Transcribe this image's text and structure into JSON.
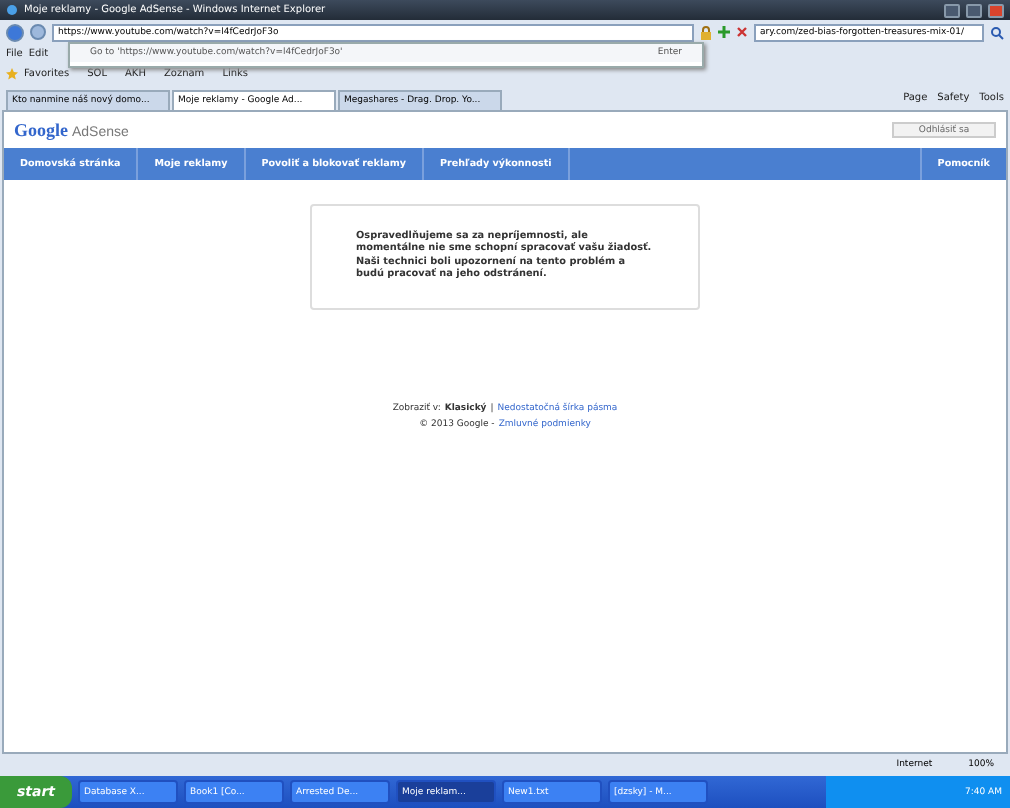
{
  "window": {
    "title": "Moje reklamy - Google AdSense - Windows Internet Explorer"
  },
  "address_bar": {
    "value": "https://www.youtube.com/watch?v=l4fCedrJoF3o",
    "search_value": "ary.com/zed-bias-forgotten-treasures-mix-01/"
  },
  "address_dropdown": {
    "suggestion": "Go to 'https://www.youtube.com/watch?v=l4fCedrJoF3o'",
    "key_hint": "Enter"
  },
  "menu": [
    "File",
    "Edit"
  ],
  "favorites_bar": {
    "label": "Favorites",
    "items": [
      "SOL",
      "AKH",
      "Zoznam",
      "Links"
    ]
  },
  "tabs": [
    {
      "label": "Kto nanmine náš nový domo...",
      "selected": false
    },
    {
      "label": "Moje reklamy - Google Ad...",
      "selected": true
    },
    {
      "label": "Megashares - Drag. Drop. Yo...",
      "selected": false
    }
  ],
  "command_bar": [
    "Page",
    "Safety",
    "Tools"
  ],
  "page": {
    "logo": {
      "brand": "Google",
      "product": "AdSense"
    },
    "sign_out": "Odhlásiť sa",
    "nav": [
      "Domovská stránka",
      "Moje reklamy",
      "Povoliť a blokovať reklamy",
      "Prehľady výkonnosti"
    ],
    "help": "Pomocník",
    "message": "Ospravedlňujeme sa za nepríjemnosti, ale momentálne nie sme schopní spracovať vašu žiadosť. Naši technici boli upozornení na tento problém a budú pracovať na jeho odstránení.",
    "footer": {
      "view_label": "Zobraziť v:",
      "view_current": "Klasický",
      "view_separator": "|",
      "view_link": "Nedostatočná šírka pásma",
      "copyright": "© 2013 Google -",
      "terms_link": "Zmluvné podmienky"
    }
  },
  "status_bar": {
    "zone": "Internet",
    "zoom": "100%"
  },
  "taskbar": {
    "start": "start",
    "items": [
      {
        "label": "Database X...",
        "selected": false
      },
      {
        "label": "Book1 [Co...",
        "selected": false
      },
      {
        "label": "Arrested De...",
        "selected": false
      },
      {
        "label": "Moje reklam...",
        "selected": true
      },
      {
        "label": "New1.txt",
        "selected": false
      },
      {
        "label": "[dzsky] - M...",
        "selected": false
      }
    ],
    "time": "7:40 AM"
  }
}
